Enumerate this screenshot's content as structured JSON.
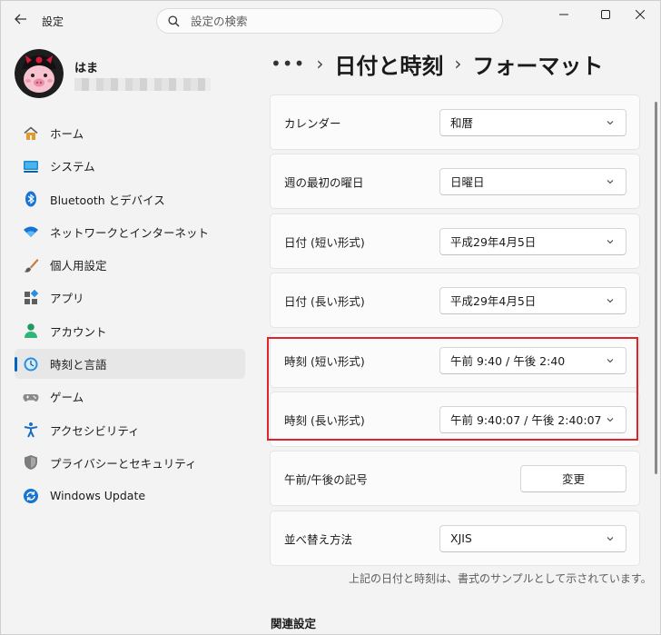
{
  "app": {
    "title": "設定"
  },
  "search": {
    "placeholder": "設定の検索"
  },
  "user": {
    "name": "はま",
    "email": "████████████████"
  },
  "nav": [
    {
      "label": "ホーム",
      "icon": "home-icon",
      "selected": false
    },
    {
      "label": "システム",
      "icon": "system-icon",
      "selected": false
    },
    {
      "label": "Bluetooth とデバイス",
      "icon": "bluetooth-icon",
      "selected": false
    },
    {
      "label": "ネットワークとインターネット",
      "icon": "wifi-icon",
      "selected": false
    },
    {
      "label": "個人用設定",
      "icon": "brush-icon",
      "selected": false
    },
    {
      "label": "アプリ",
      "icon": "apps-icon",
      "selected": false
    },
    {
      "label": "アカウント",
      "icon": "account-icon",
      "selected": false
    },
    {
      "label": "時刻と言語",
      "icon": "time-language-icon",
      "selected": true
    },
    {
      "label": "ゲーム",
      "icon": "gamepad-icon",
      "selected": false
    },
    {
      "label": "アクセシビリティ",
      "icon": "accessibility-icon",
      "selected": false
    },
    {
      "label": "プライバシーとセキュリティ",
      "icon": "shield-icon",
      "selected": false
    },
    {
      "label": "Windows Update",
      "icon": "update-icon",
      "selected": false
    }
  ],
  "breadcrumb": {
    "overflow": "•••",
    "parent": "日付と時刻",
    "current": "フォーマット"
  },
  "settings": [
    {
      "label": "カレンダー",
      "value": "和暦"
    },
    {
      "label": "週の最初の曜日",
      "value": "日曜日"
    },
    {
      "label": "日付 (短い形式)",
      "value": "平成29年4月5日"
    },
    {
      "label": "日付 (長い形式)",
      "value": "平成29年4月5日"
    },
    {
      "label": "時刻 (短い形式)",
      "value": "午前 9:40 / 午後 2:40"
    },
    {
      "label": "時刻 (長い形式)",
      "value": "午前 9:40:07 / 午後 2:40:07"
    },
    {
      "label": "午前/午後の記号",
      "button": "変更"
    },
    {
      "label": "並べ替え方法",
      "value": "XJIS"
    }
  ],
  "note": "上記の日付と時刻は、書式のサンプルとして示されています。",
  "related_heading": "関連設定",
  "colors": {
    "accent": "#0067c0",
    "highlight": "#e0232b"
  }
}
